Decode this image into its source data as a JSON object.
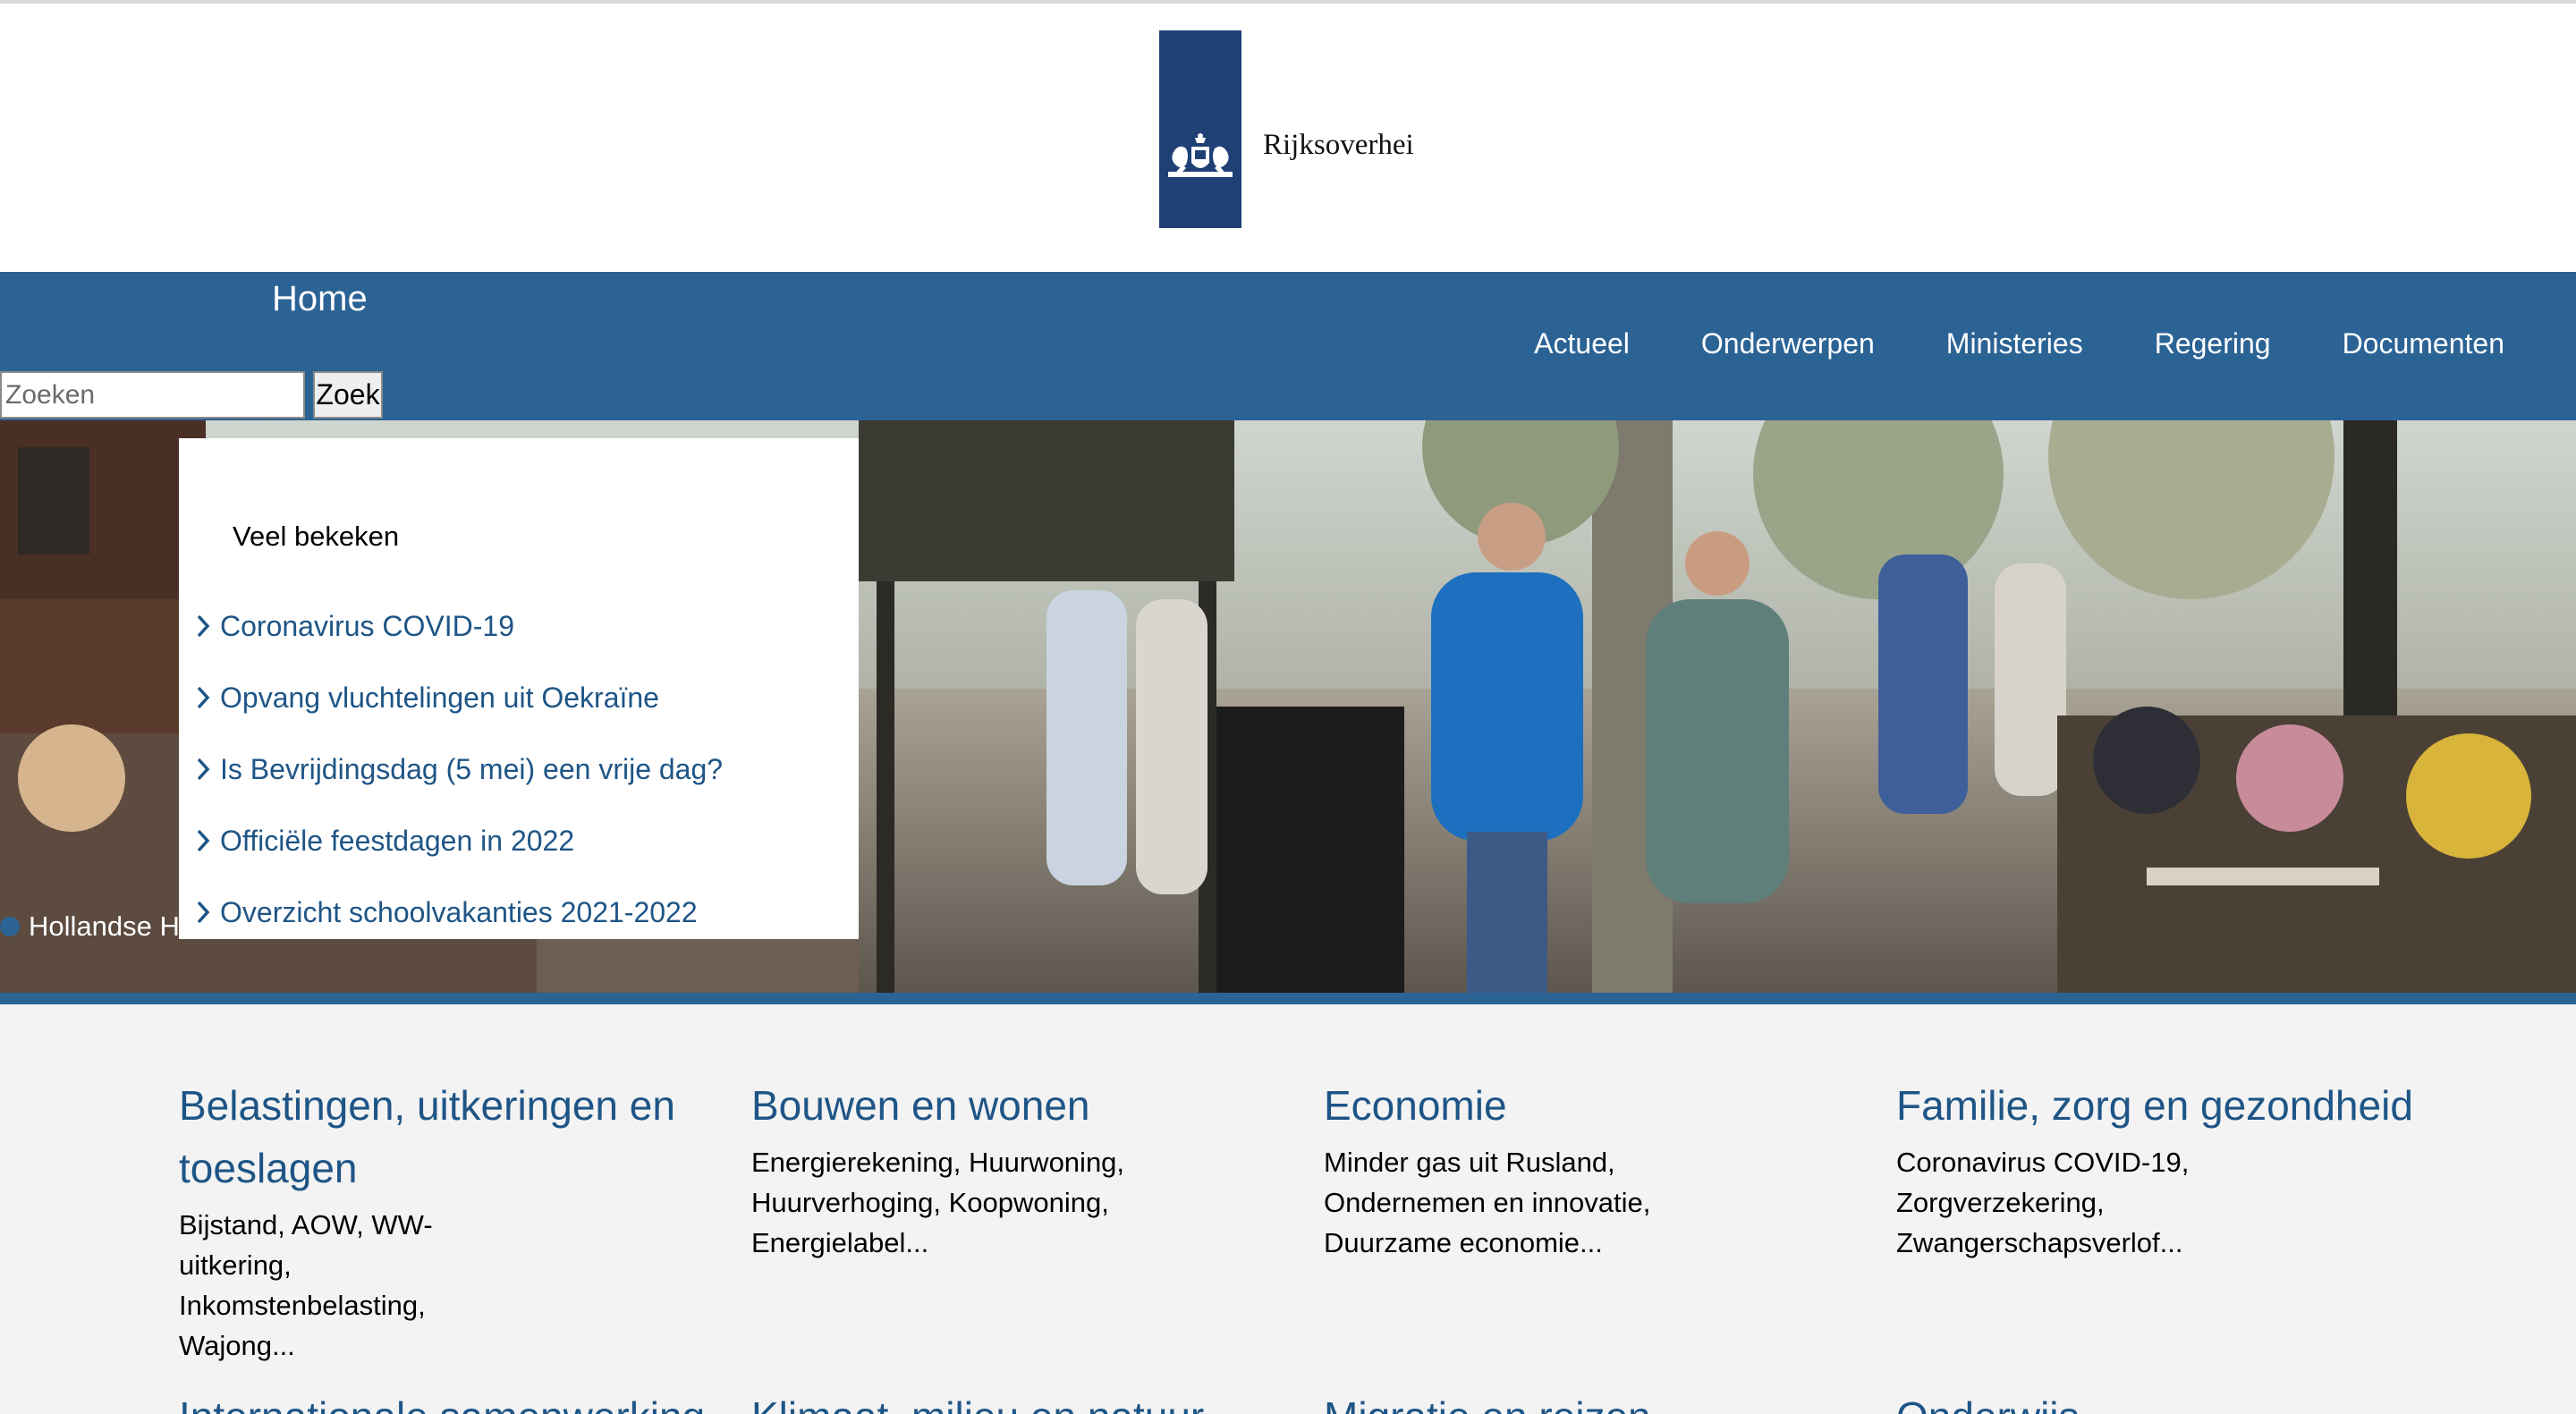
{
  "header": {
    "logo_text": "Rijksoverhei"
  },
  "nav": {
    "home": "Home",
    "items": [
      "Actueel",
      "Onderwerpen",
      "Ministeries",
      "Regering",
      "Documenten"
    ]
  },
  "search": {
    "placeholder": "Zoeken",
    "button": "Zoek"
  },
  "hero": {
    "caption": "Hollandse H"
  },
  "popular": {
    "title": "Veel bekeken",
    "links": [
      "Coronavirus COVID-19",
      "Opvang vluchtelingen uit Oekraïne",
      "Is Bevrijdingsdag (5 mei) een vrije dag?",
      "Officiële feestdagen in 2022",
      "Overzicht schoolvakanties 2021-2022"
    ]
  },
  "topics": [
    {
      "title": "Belastingen, uitkeringen en toeslagen",
      "desc": "Bijstand, AOW, WW-uitkering, Inkomstenbelasting, Wajong..."
    },
    {
      "title": "Bouwen en wonen",
      "desc": "Energierekening, Huurwoning, Huurverhoging, Koopwoning, Energielabel..."
    },
    {
      "title": "Economie",
      "desc": "Minder gas uit Rusland, Ondernemen en innovatie, Duurzame economie..."
    },
    {
      "title": "Familie, zorg en gezondheid",
      "desc": "Coronavirus COVID-19, Zorgverzekering, Zwangerschapsverlof..."
    },
    {
      "title": "Internationale samenwerking",
      "desc": ""
    },
    {
      "title": "Klimaat, milieu en natuur",
      "desc": ""
    },
    {
      "title": "Migratie en reizen",
      "desc": ""
    },
    {
      "title": "Onderwijs",
      "desc": ""
    }
  ],
  "colors": {
    "brand_blue": "#2b6395",
    "link_blue": "#1e5586",
    "logo_blue": "#1f4075"
  }
}
